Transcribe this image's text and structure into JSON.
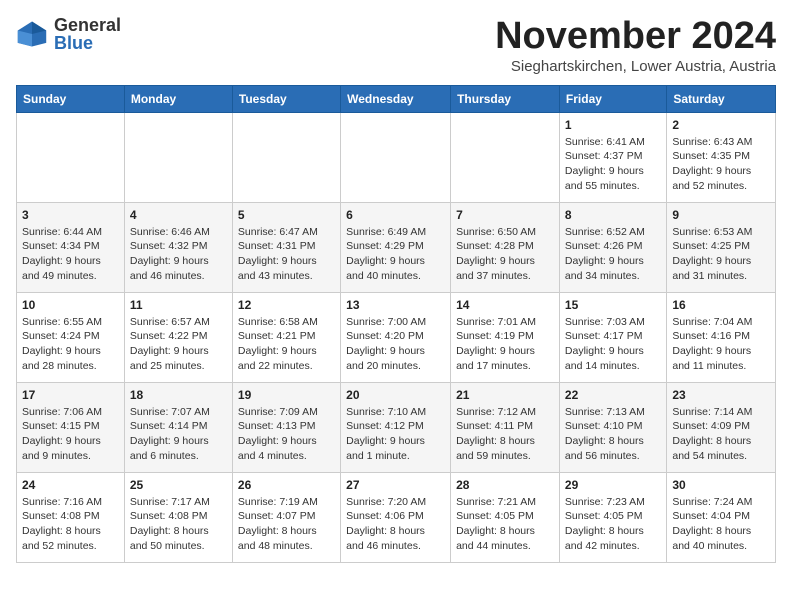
{
  "logo": {
    "general": "General",
    "blue": "Blue"
  },
  "title": "November 2024",
  "subtitle": "Sieghartskirchen, Lower Austria, Austria",
  "days_of_week": [
    "Sunday",
    "Monday",
    "Tuesday",
    "Wednesday",
    "Thursday",
    "Friday",
    "Saturday"
  ],
  "weeks": [
    [
      {
        "day": "",
        "detail": ""
      },
      {
        "day": "",
        "detail": ""
      },
      {
        "day": "",
        "detail": ""
      },
      {
        "day": "",
        "detail": ""
      },
      {
        "day": "",
        "detail": ""
      },
      {
        "day": "1",
        "detail": "Sunrise: 6:41 AM\nSunset: 4:37 PM\nDaylight: 9 hours and 55 minutes."
      },
      {
        "day": "2",
        "detail": "Sunrise: 6:43 AM\nSunset: 4:35 PM\nDaylight: 9 hours and 52 minutes."
      }
    ],
    [
      {
        "day": "3",
        "detail": "Sunrise: 6:44 AM\nSunset: 4:34 PM\nDaylight: 9 hours and 49 minutes."
      },
      {
        "day": "4",
        "detail": "Sunrise: 6:46 AM\nSunset: 4:32 PM\nDaylight: 9 hours and 46 minutes."
      },
      {
        "day": "5",
        "detail": "Sunrise: 6:47 AM\nSunset: 4:31 PM\nDaylight: 9 hours and 43 minutes."
      },
      {
        "day": "6",
        "detail": "Sunrise: 6:49 AM\nSunset: 4:29 PM\nDaylight: 9 hours and 40 minutes."
      },
      {
        "day": "7",
        "detail": "Sunrise: 6:50 AM\nSunset: 4:28 PM\nDaylight: 9 hours and 37 minutes."
      },
      {
        "day": "8",
        "detail": "Sunrise: 6:52 AM\nSunset: 4:26 PM\nDaylight: 9 hours and 34 minutes."
      },
      {
        "day": "9",
        "detail": "Sunrise: 6:53 AM\nSunset: 4:25 PM\nDaylight: 9 hours and 31 minutes."
      }
    ],
    [
      {
        "day": "10",
        "detail": "Sunrise: 6:55 AM\nSunset: 4:24 PM\nDaylight: 9 hours and 28 minutes."
      },
      {
        "day": "11",
        "detail": "Sunrise: 6:57 AM\nSunset: 4:22 PM\nDaylight: 9 hours and 25 minutes."
      },
      {
        "day": "12",
        "detail": "Sunrise: 6:58 AM\nSunset: 4:21 PM\nDaylight: 9 hours and 22 minutes."
      },
      {
        "day": "13",
        "detail": "Sunrise: 7:00 AM\nSunset: 4:20 PM\nDaylight: 9 hours and 20 minutes."
      },
      {
        "day": "14",
        "detail": "Sunrise: 7:01 AM\nSunset: 4:19 PM\nDaylight: 9 hours and 17 minutes."
      },
      {
        "day": "15",
        "detail": "Sunrise: 7:03 AM\nSunset: 4:17 PM\nDaylight: 9 hours and 14 minutes."
      },
      {
        "day": "16",
        "detail": "Sunrise: 7:04 AM\nSunset: 4:16 PM\nDaylight: 9 hours and 11 minutes."
      }
    ],
    [
      {
        "day": "17",
        "detail": "Sunrise: 7:06 AM\nSunset: 4:15 PM\nDaylight: 9 hours and 9 minutes."
      },
      {
        "day": "18",
        "detail": "Sunrise: 7:07 AM\nSunset: 4:14 PM\nDaylight: 9 hours and 6 minutes."
      },
      {
        "day": "19",
        "detail": "Sunrise: 7:09 AM\nSunset: 4:13 PM\nDaylight: 9 hours and 4 minutes."
      },
      {
        "day": "20",
        "detail": "Sunrise: 7:10 AM\nSunset: 4:12 PM\nDaylight: 9 hours and 1 minute."
      },
      {
        "day": "21",
        "detail": "Sunrise: 7:12 AM\nSunset: 4:11 PM\nDaylight: 8 hours and 59 minutes."
      },
      {
        "day": "22",
        "detail": "Sunrise: 7:13 AM\nSunset: 4:10 PM\nDaylight: 8 hours and 56 minutes."
      },
      {
        "day": "23",
        "detail": "Sunrise: 7:14 AM\nSunset: 4:09 PM\nDaylight: 8 hours and 54 minutes."
      }
    ],
    [
      {
        "day": "24",
        "detail": "Sunrise: 7:16 AM\nSunset: 4:08 PM\nDaylight: 8 hours and 52 minutes."
      },
      {
        "day": "25",
        "detail": "Sunrise: 7:17 AM\nSunset: 4:08 PM\nDaylight: 8 hours and 50 minutes."
      },
      {
        "day": "26",
        "detail": "Sunrise: 7:19 AM\nSunset: 4:07 PM\nDaylight: 8 hours and 48 minutes."
      },
      {
        "day": "27",
        "detail": "Sunrise: 7:20 AM\nSunset: 4:06 PM\nDaylight: 8 hours and 46 minutes."
      },
      {
        "day": "28",
        "detail": "Sunrise: 7:21 AM\nSunset: 4:05 PM\nDaylight: 8 hours and 44 minutes."
      },
      {
        "day": "29",
        "detail": "Sunrise: 7:23 AM\nSunset: 4:05 PM\nDaylight: 8 hours and 42 minutes."
      },
      {
        "day": "30",
        "detail": "Sunrise: 7:24 AM\nSunset: 4:04 PM\nDaylight: 8 hours and 40 minutes."
      }
    ]
  ]
}
